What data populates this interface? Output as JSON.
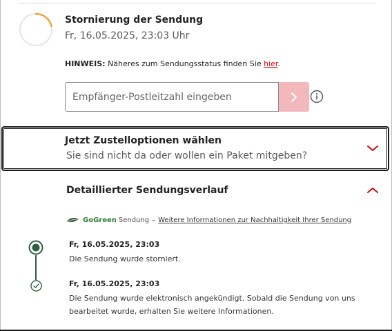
{
  "status": {
    "title": "Stornierung der Sendung",
    "date": "Fr, 16.05.2025, 23:03 Uhr",
    "progress_color": "#f0a030"
  },
  "hint": {
    "label": "HINWEIS:",
    "text": "Näheres zum Sendungsstatus finden Sie",
    "link": "hier",
    "suffix": "."
  },
  "plz": {
    "placeholder": "Empfänger-Postleitzahl eingeben",
    "submit_icon": "chevron-right-icon",
    "info_icon": "info-icon"
  },
  "options": {
    "title": "Jetzt Zustelloptionen wählen",
    "subtitle": "Sie sind nicht da oder wollen ein Paket mitgeben?",
    "icon": "chevron-down-icon"
  },
  "history": {
    "title": "Detaillierter Sendungsverlauf",
    "icon": "chevron-up-icon",
    "gogreen": {
      "brand": "GoGreen",
      "text": "Sendung",
      "separator": "–",
      "link": "Weitere Informationen zur Nachhaltigkeit Ihrer Sendung"
    },
    "events": [
      {
        "date": "Fr, 16.05.2025, 23:03",
        "text_lines": [
          "Die Sendung wurde storniert."
        ]
      },
      {
        "date": "Fr, 16.05.2025, 23:03",
        "text_lines": [
          "Die Sendung wurde elektronisch angekündigt. Sobald die Sendung von uns",
          "bearbeitet wurde, erhalten Sie weitere Informationen."
        ]
      }
    ]
  },
  "colors": {
    "accent_red": "#d40511",
    "green": "#2e5e3e",
    "submit_bg": "#f2b8bc"
  }
}
